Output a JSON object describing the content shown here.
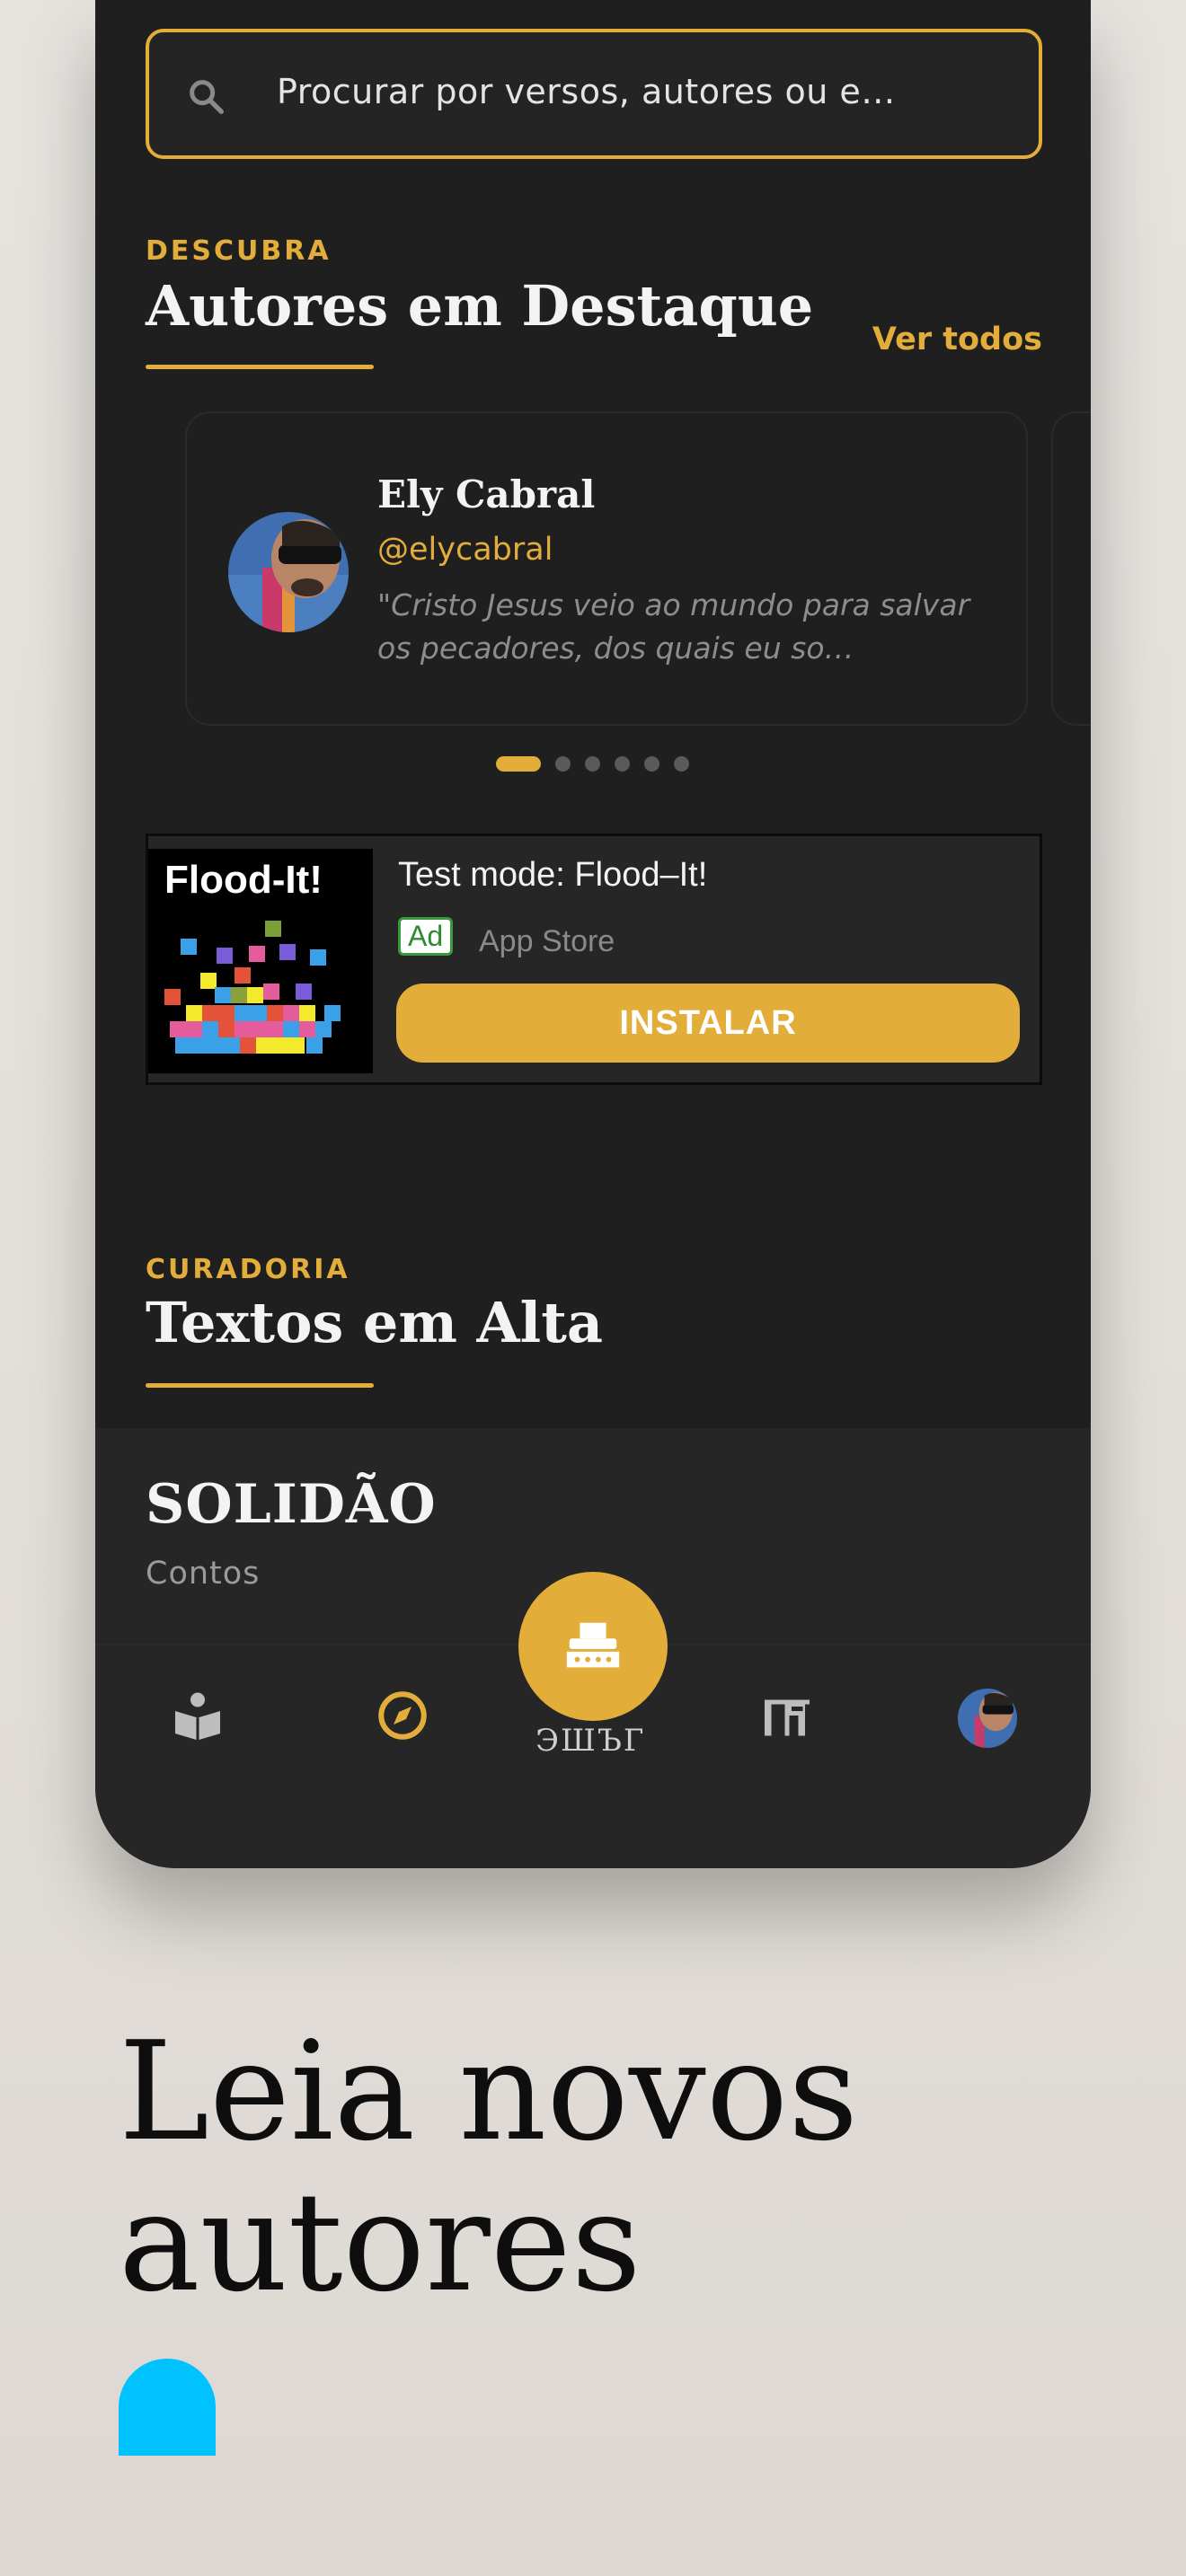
{
  "search": {
    "placeholder": "Procurar por versos, autores ou e…"
  },
  "featured": {
    "eyebrow": "DESCUBRA",
    "title": "Autores em Destaque",
    "see_all": "Ver todos",
    "author": {
      "name": "Ely Cabral",
      "handle": "@elycabral",
      "quote": "\"Cristo Jesus veio ao mundo para salvar os pecadores, dos quais eu so…"
    },
    "pagination": {
      "total": 6,
      "active": 1
    }
  },
  "ad": {
    "image_title": "Flood-It!",
    "title": "Test mode: Flood–It!",
    "badge": "Ad",
    "store": "App Store",
    "cta": "INSTALAR"
  },
  "trending": {
    "eyebrow": "CURADORIA",
    "title": "Textos em Alta",
    "item": {
      "title": "SOLIDÃO",
      "category": "Contos"
    }
  },
  "tabbar": {
    "arc_text": "ЭШЪГ",
    "items": [
      {
        "icon": "book-reader-icon"
      },
      {
        "icon": "compass-icon",
        "active": true
      },
      {
        "icon": "typewriter-icon"
      },
      {
        "icon": "desk-icon"
      },
      {
        "icon": "profile-avatar"
      }
    ]
  },
  "promo": {
    "headline": "Leia novos\nautores"
  },
  "colors": {
    "accent": "#e3ad3a",
    "background": "#1f1f1f",
    "blob": "#00c2ff"
  }
}
